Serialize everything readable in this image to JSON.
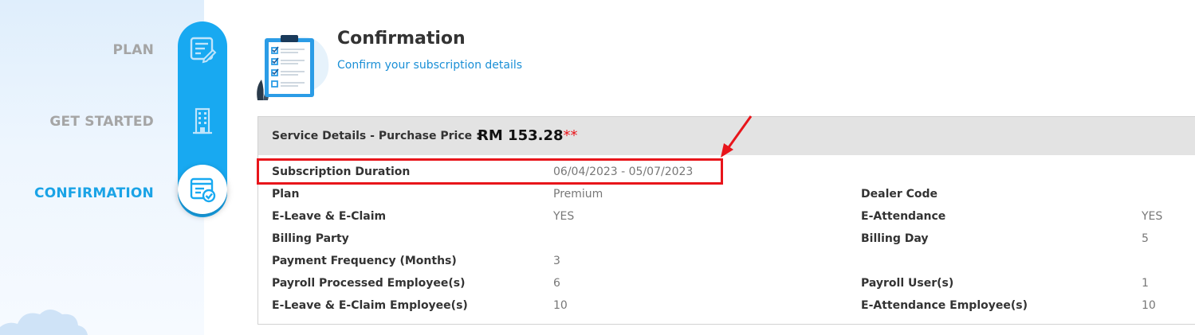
{
  "stepper": {
    "steps": [
      {
        "label": "PLAN",
        "icon": "plan-document-icon",
        "state": "completed"
      },
      {
        "label": "GET STARTED",
        "icon": "building-icon",
        "state": "completed"
      },
      {
        "label": "CONFIRMATION",
        "icon": "confirmation-check-icon",
        "state": "active"
      }
    ]
  },
  "header": {
    "title": "Confirmation",
    "subtitle": "Confirm your subscription details",
    "illustration": "clipboard-checklist-illustration"
  },
  "service": {
    "heading": "Service Details - Purchase Price :",
    "price": "RM 153.28",
    "price_marker": "**"
  },
  "details": {
    "subscription_duration": {
      "label": "Subscription Duration",
      "value": "06/04/2023 - 05/07/2023"
    },
    "plan": {
      "label": "Plan",
      "value": "Premium"
    },
    "dealer_code": {
      "label": "Dealer Code",
      "value": ""
    },
    "eleave_eclaim": {
      "label": "E-Leave & E-Claim",
      "value": "YES"
    },
    "eattendance": {
      "label": "E-Attendance",
      "value": "YES"
    },
    "billing_party": {
      "label": "Billing Party",
      "value": ""
    },
    "billing_day": {
      "label": "Billing Day",
      "value": "5"
    },
    "payment_frequency": {
      "label": "Payment Frequency (Months)",
      "value": "3"
    },
    "payroll_employees": {
      "label": "Payroll Processed Employee(s)",
      "value": "6"
    },
    "payroll_users": {
      "label": "Payroll User(s)",
      "value": "1"
    },
    "eleave_employees": {
      "label": "E-Leave & E-Claim Employee(s)",
      "value": "10"
    },
    "eattendance_employees": {
      "label": "E-Attendance Employee(s)",
      "value": "10"
    }
  },
  "colors": {
    "accent": "#18a9f1",
    "active_step_text": "#1aa3e6",
    "highlight": "#e8151b",
    "panel_header": "#e3e3e3"
  }
}
